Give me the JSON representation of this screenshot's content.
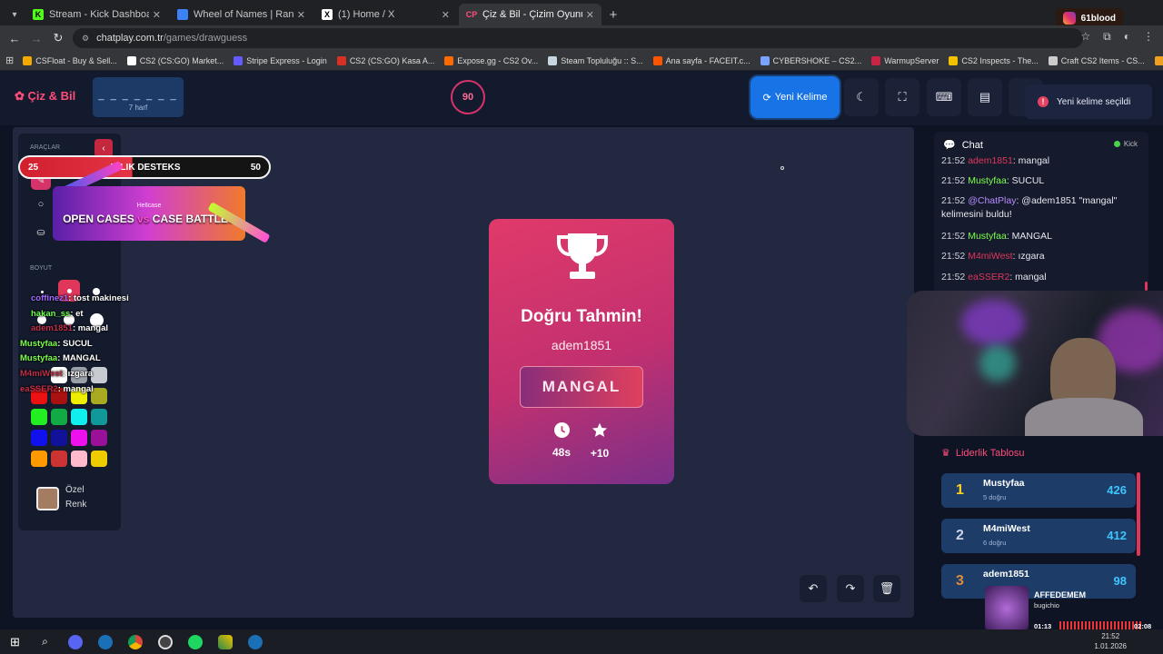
{
  "browser": {
    "tabs": [
      {
        "title": "Stream - Kick Dashboard",
        "fav_color": "#53fc18",
        "fav_glyph": "K",
        "active": false
      },
      {
        "title": "Wheel of Names | Random nam",
        "fav_color": "#3b82f6",
        "fav_glyph": "",
        "active": false
      },
      {
        "title": "(1) Home / X",
        "fav_color": "#ffffff",
        "fav_glyph": "X",
        "active": false
      },
      {
        "title": "Çiz & Bil - Çizim Oyunu",
        "fav_color": "#ff4d7a",
        "fav_glyph": "CP",
        "active": true
      }
    ],
    "url_host": "chatplay.com.tr",
    "url_path": "/games/drawguess",
    "instagram_name": "61blood",
    "bookmarks": [
      {
        "label": "CSFloat - Buy & Sell...",
        "color": "#f2a900"
      },
      {
        "label": "CS2 (CS:GO) Market...",
        "color": "#ffffff"
      },
      {
        "label": "Stripe Express - Login",
        "color": "#635bff"
      },
      {
        "label": "CS2 (CS:GO) Kasa A...",
        "color": "#d93025"
      },
      {
        "label": "Expose.gg - CS2 Ov...",
        "color": "#ff6a00"
      },
      {
        "label": "Steam Topluluğu :: S...",
        "color": "#c7d5e0"
      },
      {
        "label": "Ana sayfa - FACEIT.c...",
        "color": "#ff5500"
      },
      {
        "label": "CYBERSHOKE – CS2...",
        "color": "#7aa2ff"
      },
      {
        "label": "WarmupServer",
        "color": "#cc2244"
      },
      {
        "label": "CS2 Inspects - The...",
        "color": "#f2c200"
      },
      {
        "label": "Craft CS2 Items - CS...",
        "color": "#cccccc"
      },
      {
        "label": "CSNADES.gg - Cou...",
        "color": "#f0a020"
      }
    ]
  },
  "header": {
    "logo": "Çiz & Bil",
    "word_mask": "_ _ _ _ _ _ _",
    "word_length": "7 harf",
    "timer": "90",
    "new_word_label": "Yeni Kelime",
    "toast": "Yeni kelime seçildi"
  },
  "tools": {
    "section_tools": "ARAÇLAR",
    "section_size": "BOYUT",
    "custom_color_line1": "Özel",
    "custom_color_line2": "Renk",
    "palette": [
      "#e11",
      "#a11",
      "#ee0",
      "#aa2",
      "#2e2",
      "#1a4",
      "#1ee",
      "#199",
      "#11e",
      "#119",
      "#e1e",
      "#919",
      "#f90",
      "#c33",
      "#fbc",
      "#ec0"
    ]
  },
  "overlay": {
    "goal_current": "25",
    "goal_title": "AYLIK DESTEKS",
    "goal_target": "50",
    "ad_brand": "Hellcase",
    "ad_left": "OPEN CASES",
    "ad_vs": "vs",
    "ad_right": "CASE BATTLES",
    "chat": [
      {
        "user": "coffinez1",
        "text": ": tost makinesi",
        "color": "#a46bff"
      },
      {
        "user": "hakan_ss",
        "text": ": et",
        "color": "#6cff4a"
      },
      {
        "user": "adem1851",
        "text": ": mangal",
        "color": "#c0304a"
      },
      {
        "user": "Mustyfaa",
        "text": ": SUCUL",
        "color": "#7dff4a"
      },
      {
        "user": "Mustyfaa",
        "text": ": MANGAL",
        "color": "#7dff4a"
      },
      {
        "user": "M4miWest",
        "text": ": ızgara",
        "color": "#c0304a"
      },
      {
        "user": "eaSSER2",
        "text": ": mangal",
        "color": "#c0304a"
      }
    ]
  },
  "result": {
    "title": "Doğru Tahmin!",
    "guesser": "adem1851",
    "word": "MANGAL",
    "time": "48s",
    "points": "+10"
  },
  "chat": {
    "title": "Chat",
    "platform": "Kick",
    "messages": [
      {
        "time": "21:52",
        "user": "adem1851",
        "text": ": mangal",
        "color": "#e0365a"
      },
      {
        "time": "21:52",
        "user": "Mustyfaa",
        "text": ": SUCUL",
        "color": "#7dff4a"
      },
      {
        "time": "21:52",
        "user": "@ChatPlay",
        "text": ": @adem1851 \"mangal\" kelimesini buldu!",
        "color": "#b98cff"
      },
      {
        "time": "21:52",
        "user": "Mustyfaa",
        "text": ": MANGAL",
        "color": "#7dff4a"
      },
      {
        "time": "21:52",
        "user": "M4miWest",
        "text": ": ızgara",
        "color": "#e0365a"
      },
      {
        "time": "21:52",
        "user": "eaSSER2",
        "text": ": mangal",
        "color": "#e0365a"
      }
    ]
  },
  "leaderboard": {
    "title": "Liderlik Tablosu",
    "rows": [
      {
        "rank": "1",
        "name": "Mustyfaa",
        "sub": "5 doğru",
        "points": "426",
        "rank_color": "#ffd21a"
      },
      {
        "rank": "2",
        "name": "M4miWest",
        "sub": "6 doğru",
        "points": "412",
        "rank_color": "#c9d2e6"
      },
      {
        "rank": "3",
        "name": "adem1851",
        "sub": "",
        "points": "98",
        "rank_color": "#e08a3a"
      }
    ]
  },
  "music": {
    "title": "AFFEDEMEM",
    "artist": "bugichio",
    "elapsed": "01:13",
    "duration": "02:08"
  },
  "taskbar": {
    "time": "21:52",
    "date": "1.01.2026"
  }
}
